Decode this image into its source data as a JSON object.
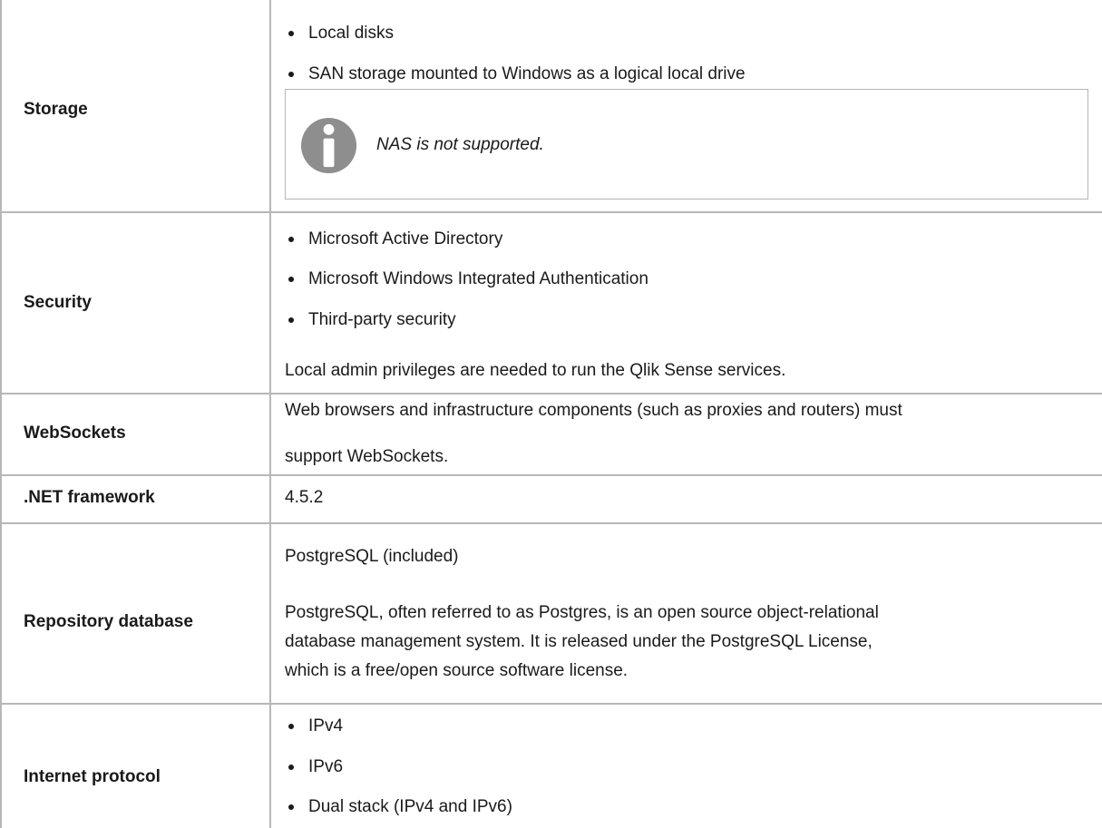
{
  "rows": {
    "storage": {
      "label": "Storage",
      "bullets": [
        "Local disks",
        "SAN storage mounted to Windows as a logical local drive"
      ],
      "note": {
        "icon": "info-icon",
        "text": "NAS is not supported."
      }
    },
    "security": {
      "label": "Security",
      "bullets": [
        "Microsoft Active Directory",
        "Microsoft Windows Integrated Authentication",
        "Third-party security"
      ],
      "text": "Local admin privileges are needed to run the Qlik Sense services."
    },
    "websockets": {
      "label": "WebSockets",
      "lines": [
        "Web browsers and infrastructure components (such as proxies and routers) must",
        "support WebSockets."
      ]
    },
    "dotnet": {
      "label": ".NET framework",
      "value": "4.5.2"
    },
    "repository": {
      "label": "Repository database",
      "title": "PostgreSQL (included)",
      "lines": [
        "PostgreSQL, often referred to as Postgres, is an open source object-relational",
        "database management system. It is released under the PostgreSQL License,",
        "which is a free/open source software license."
      ]
    },
    "internet": {
      "label": "Internet protocol",
      "bullets": [
        "IPv4",
        "IPv6",
        "Dual stack (IPv4 and IPv6)"
      ]
    }
  },
  "colors": {
    "border": "#b7b7b7",
    "text": "#1a1a1a",
    "icon": "#8e8e8e"
  }
}
